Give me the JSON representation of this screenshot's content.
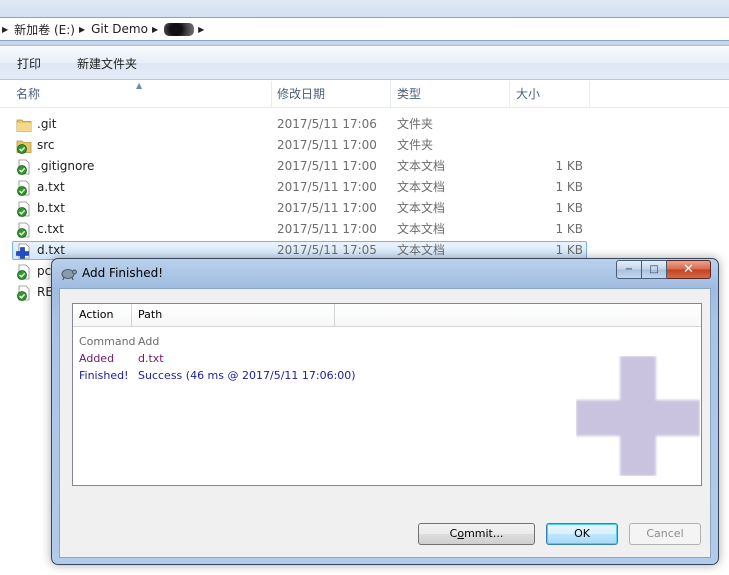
{
  "breadcrumb": [
    "新加卷 (E:)",
    "Git Demo"
  ],
  "toolbar": {
    "print": "打印",
    "new_folder": "新建文件夹"
  },
  "columns": {
    "name": "名称",
    "date": "修改日期",
    "type": "类型",
    "size": "大小"
  },
  "files": [
    {
      "name": ".git",
      "date": "2017/5/11 17:06",
      "type": "文件夹",
      "size": "",
      "icon": "folder-icon"
    },
    {
      "name": "src",
      "date": "2017/5/11 17:00",
      "type": "文件夹",
      "size": "",
      "icon": "folder-versioned-icon"
    },
    {
      "name": ".gitignore",
      "date": "2017/5/11 17:00",
      "type": "文本文档",
      "size": "1 KB",
      "icon": "file-versioned-icon"
    },
    {
      "name": "a.txt",
      "date": "2017/5/11 17:00",
      "type": "文本文档",
      "size": "1 KB",
      "icon": "file-versioned-icon"
    },
    {
      "name": "b.txt",
      "date": "2017/5/11 17:00",
      "type": "文本文档",
      "size": "1 KB",
      "icon": "file-versioned-icon"
    },
    {
      "name": "c.txt",
      "date": "2017/5/11 17:00",
      "type": "文本文档",
      "size": "1 KB",
      "icon": "file-versioned-icon"
    },
    {
      "name": "d.txt",
      "date": "2017/5/11 17:05",
      "type": "文本文档",
      "size": "1 KB",
      "icon": "file-added-icon"
    },
    {
      "name": "pc",
      "date": "",
      "type": "",
      "size": "",
      "icon": "file-versioned-icon"
    },
    {
      "name": "RE",
      "date": "",
      "type": "",
      "size": "",
      "icon": "file-versioned-icon"
    }
  ],
  "dialog": {
    "title": "Add Finished!",
    "list_headers": {
      "action": "Action",
      "path": "Path"
    },
    "rows": [
      {
        "action": "Command",
        "path": "Add",
        "color": "#6d6d6d"
      },
      {
        "action": "Added",
        "path": "d.txt",
        "color": "#6a1a6e"
      },
      {
        "action": "Finished!",
        "path": "Success (46 ms @ 2017/5/11 17:06:00)",
        "color": "#1c1ca2"
      }
    ],
    "buttons": {
      "commit_prefix": "C",
      "commit_hotkey": "o",
      "commit_suffix": "mmit...",
      "ok": "OK",
      "cancel": "Cancel"
    },
    "window_buttons": {
      "minimize": "−",
      "maximize": "□",
      "close": "✕"
    }
  },
  "colors": {
    "accent_selection": "#d2e6fb",
    "dialog_frame": "#a9c4e6",
    "plus_watermark": "#c9c3df"
  }
}
